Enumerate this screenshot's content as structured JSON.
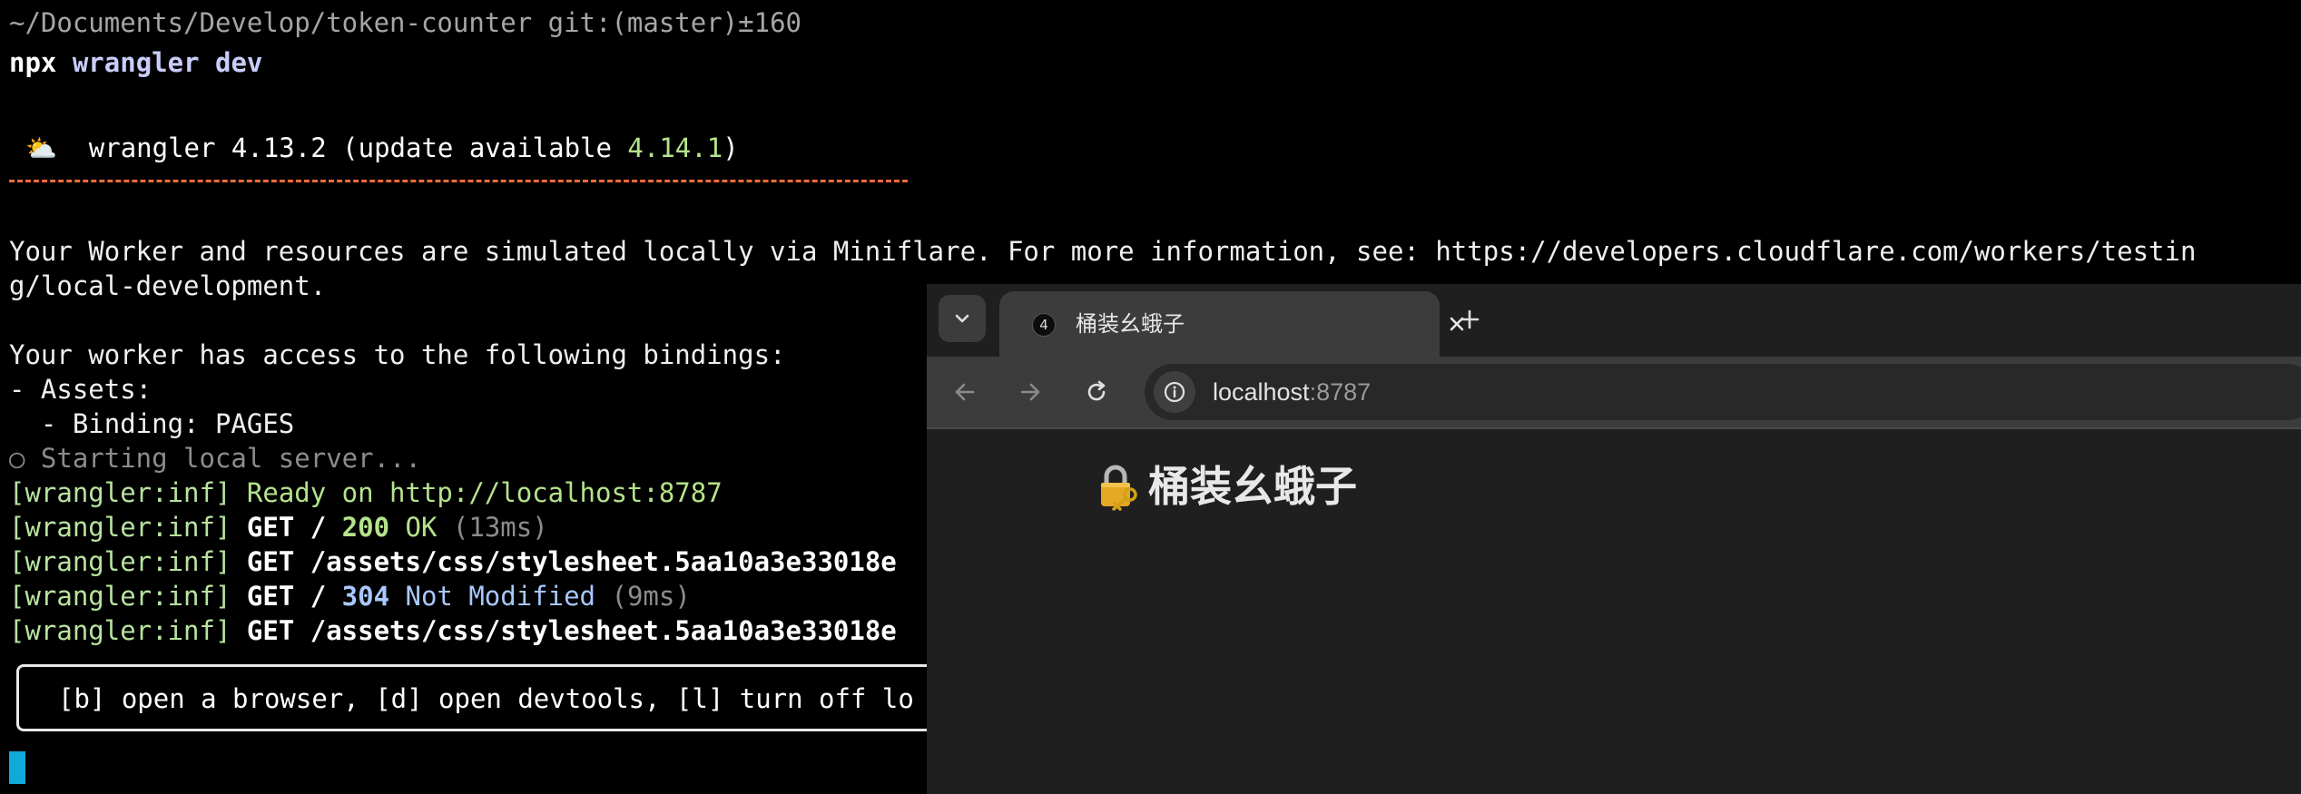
{
  "terminal": {
    "prompt_path": "~/Documents/Develop/token-counter",
    "prompt_git": " git:(master)±160",
    "command_npx": "npx",
    "command_args": " wrangler dev",
    "banner_prefix": "wrangler 4.13.2 (update available ",
    "banner_version": "4.14.1",
    "banner_suffix": ")",
    "info_line_1": "Your Worker and resources are simulated locally via Miniflare. For more information, see: https://developers.cloudflare.com/workers/testin",
    "info_line_2": "g/local-development.",
    "bindings_intro": "Your worker has access to the following bindings:",
    "bindings_assets": "- Assets:",
    "bindings_binding": "  - Binding: PAGES",
    "starting": "○ Starting local server...",
    "log_prefix": "[wrangler:inf]",
    "log_ready": " Ready on http://localhost:8787",
    "log2_method": " GET / ",
    "log2_status": "200",
    "log2_text": " OK",
    "log2_time": " (13ms)",
    "log3_method": " GET /assets/css/stylesheet.5aa10a3e33018e",
    "log4_method": " GET / ",
    "log4_status": "304",
    "log4_text": " Not Modified",
    "log4_time": " (9ms)",
    "log5_method": " GET /assets/css/stylesheet.5aa10a3e33018e",
    "hint": "[b] open a browser, [d] open devtools, [l] turn off lo"
  },
  "browser": {
    "tab_title": "桶装幺蛾子",
    "tab_favicon_text": "4",
    "url_host": "localhost",
    "url_port": ":8787",
    "page_heading": "桶装幺蛾子"
  },
  "colors": {
    "terminal_bg": "#000000",
    "accent_green": "#b5e38c",
    "accent_orange": "#f16b3a",
    "cursor": "#11a9d8",
    "browser_bg": "#1f1f1f",
    "toolbar_bg": "#3c3c3c"
  },
  "icons": {
    "weather": "sun-behind-cloud-icon",
    "tab_search": "chevron-down-icon",
    "close": "close-icon",
    "new_tab": "plus-icon",
    "back": "arrow-left-icon",
    "forward": "arrow-right-icon",
    "reload": "reload-icon",
    "site_info": "info-icon",
    "heading": "lock-with-key-icon"
  }
}
